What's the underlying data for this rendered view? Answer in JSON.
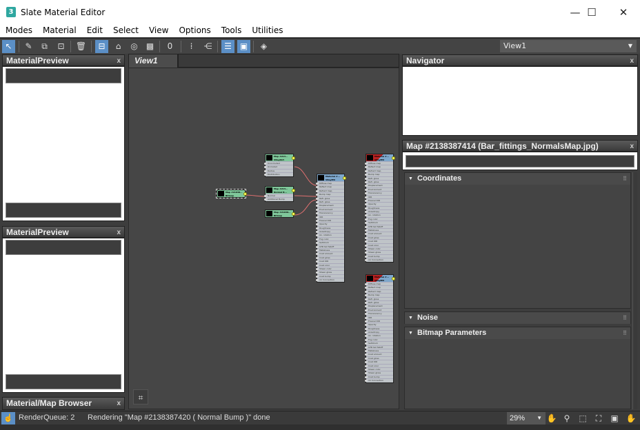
{
  "window": {
    "title": "Slate Material Editor",
    "icon_label": "3",
    "minimize": "—",
    "maximize": "☐",
    "close": "✕"
  },
  "menu": [
    "Modes",
    "Material",
    "Edit",
    "Select",
    "View",
    "Options",
    "Tools",
    "Utilities"
  ],
  "toolbar": {
    "view_select": "View1"
  },
  "left_panels": {
    "preview1": "MaterialPreview",
    "preview2": "MaterialPreview",
    "browser": "Material/Map Browser",
    "close": "x"
  },
  "view_tab": "View1",
  "navigator": {
    "title": "Navigator",
    "close": "x"
  },
  "param_panel": {
    "title": "Map #2138387414 (Bar_fittings_NormalsMap.jpg)",
    "close": "x",
    "rollouts": [
      "Coordinates",
      "Noise",
      "Bitmap Parameters"
    ]
  },
  "nodes": {
    "bitmap_left": {
      "title": "Map #21838...",
      "type": "Bitmap",
      "slots": []
    },
    "vraydirt": {
      "title": "Map #213...",
      "type": "VRayDirt",
      "slots": [
        "Unoccluded",
        "Occluded",
        "Radius",
        "Distribution"
      ]
    },
    "normal_bump": {
      "title": "Map #213...",
      "type": "Normal B...",
      "slots": [
        "Normal",
        "Additional Bump"
      ]
    },
    "bitmap2": {
      "title": "Map #21838...",
      "type": "Bitmap",
      "slots": []
    },
    "vraymtl": {
      "title": "Material #...",
      "type": "VRayMtl",
      "slots": [
        "Diffuse map",
        "Reflect map",
        "Refract map",
        "Bump map",
        "Refl. gloss",
        "Refr. gloss",
        "Displacement",
        "Environment",
        "Translucency",
        "IOR",
        "Fresnel IOR",
        "Opacity",
        "Roughness",
        "Anisotropy",
        "An. rotation",
        "Fog color",
        "Self-illum",
        "GTR tail falloff",
        "Metalness",
        "Coat amount",
        "Coat gloss",
        "Coat IOR",
        "Coat color",
        "Sheen color",
        "Sheen gloss",
        "Coat bump",
        "mr Connection"
      ]
    },
    "mtl_right1": {
      "title": "Material #...",
      "type": "VRayMtl",
      "slots": [
        "Diffuse map",
        "Reflect map",
        "Refract map",
        "Bump map",
        "Refl. gloss",
        "Refr. gloss",
        "Displacement",
        "Environment",
        "Translucency",
        "IOR",
        "Fresnel IOR",
        "Opacity",
        "Roughness",
        "Anisotropy",
        "An. rotation",
        "Fog color",
        "Self-illum",
        "GTR tail falloff",
        "Metalness",
        "Coat amount",
        "Coat gloss",
        "Coat IOR",
        "Coat color",
        "Sheen color",
        "Sheen gloss",
        "Coat bump",
        "mr Connection"
      ]
    },
    "mtl_right2": {
      "title": "Material #...",
      "type": "VRayMtl",
      "slots": [
        "Diffuse map",
        "Reflect map",
        "Refract map",
        "Bump map",
        "Refl. gloss",
        "Refr. gloss",
        "Displacement",
        "Environment",
        "Translucency",
        "IOR",
        "Fresnel IOR",
        "Opacity",
        "Roughness",
        "Anisotropy",
        "An. rotation",
        "Fog color",
        "Self-illum",
        "GTR tail falloff",
        "Metalness",
        "Coat amount",
        "Coat gloss",
        "Coat IOR",
        "Coat color",
        "Sheen color",
        "Sheen gloss",
        "Coat bump",
        "mr Connection"
      ]
    }
  },
  "status": {
    "render_queue": "RenderQueue: 2",
    "message": "Rendering \"Map #2138387420  ( Normal Bump )\" done",
    "zoom": "29%"
  },
  "colors": {
    "accent": "#5b8fc6",
    "wire": "#e06060",
    "map_node": "#7fc79a",
    "material_node": "#7ea7cc"
  }
}
